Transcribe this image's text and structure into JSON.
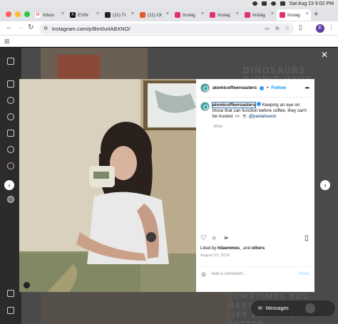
{
  "menubar": {
    "datetime": "Sat Aug 23  9:02 PM"
  },
  "tabs": [
    {
      "label": "Inbox",
      "favicon_color": "#ffffff",
      "favicon_text": "M"
    },
    {
      "label": "EVW",
      "favicon_color": "#111111",
      "favicon_text": "X"
    },
    {
      "label": "(11) Tr",
      "favicon_color": "#222222",
      "favicon_text": ""
    },
    {
      "label": "(11) Ot",
      "favicon_color": "#e05a2a",
      "favicon_text": ""
    },
    {
      "label": "Instag",
      "favicon_color": "#e1306c",
      "favicon_text": ""
    },
    {
      "label": "Instag",
      "favicon_color": "#e1306c",
      "favicon_text": ""
    },
    {
      "label": "Instag",
      "favicon_color": "#e1306c",
      "favicon_text": ""
    },
    {
      "label": "Instag",
      "favicon_color": "#e1306c",
      "favicon_text": ""
    }
  ],
  "address_bar": {
    "url": "instagram.com/p/Bm0urlABXNO/",
    "profile_initial": "E"
  },
  "background": {
    "text_top": "DINOSAURS DIDN'T HAVE COFFEE",
    "text_bottom": "SOMETIMES YOU MEET PEOPLE T... LIFE FOR THE BETTER."
  },
  "post": {
    "username": "atomicoffeeroasters",
    "follow_label": "Follow",
    "caption": "Keeping an eye on those that can function before coffee, they can't be trusted. 👀 ☕️ ",
    "mention": "@paolahueck",
    "caption_age": "369w",
    "likes_prefix": "Liked by ",
    "likes_user": "hilaemmes_",
    "likes_mid": " and ",
    "likes_others": "others",
    "date": "August 23, 2018",
    "comment_placeholder": "Add a comment...",
    "post_label": "Post"
  },
  "messages_label": "Messages",
  "colors": {
    "accent": "#0095f6",
    "verified": "#3897f0"
  }
}
